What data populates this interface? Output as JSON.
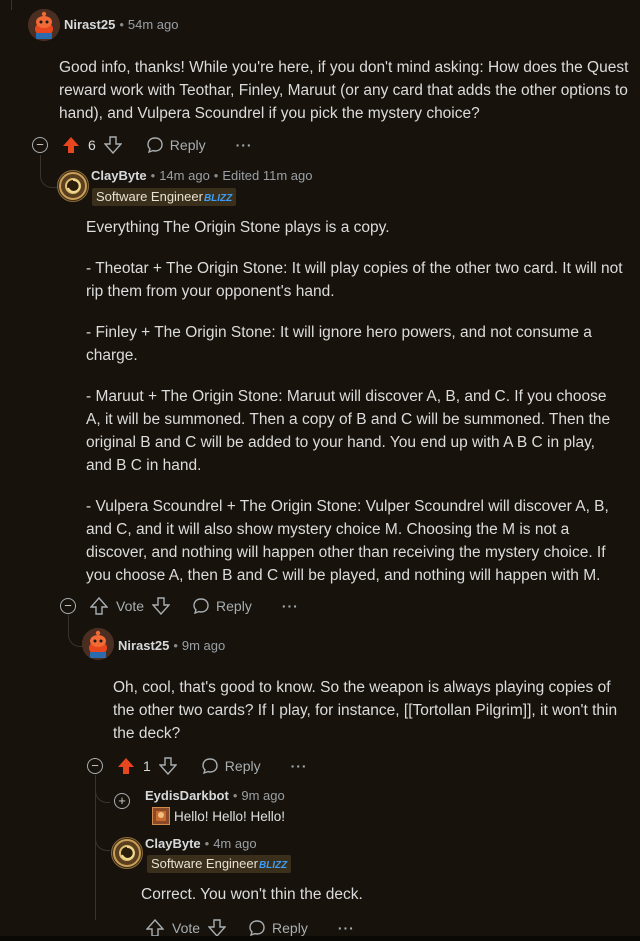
{
  "comments": [
    {
      "user": "Nirast25",
      "time": "54m ago",
      "body": [
        "Good info, thanks! While you're here, if you don't mind asking: How does the Quest reward work with Teothar, Finley, Maruut (or any card that adds the other options to hand), and Vulpera Scoundrel if you pick the mystery choice?"
      ],
      "score": "6",
      "reply_label": "Reply",
      "more_label": "···"
    },
    {
      "user": "ClayByte",
      "time": "14m ago",
      "edited": "Edited 11m ago",
      "flair": "Software Engineer",
      "flair_badge": "BLIZZ",
      "body": [
        "Everything The Origin Stone plays is a copy.",
        "- Theotar + The Origin Stone: It will play copies of the other two card. It will not rip them from your opponent's hand.",
        "- Finley + The Origin Stone: It will ignore hero powers, and not consume a charge.",
        "- Maruut + The Origin Stone: Maruut will discover A, B, and C. If you choose A, it will be summoned. Then a copy of B and C will be summoned. Then the original B and C will be added to your hand. You end up with A B C in play, and B C in hand.",
        "- Vulpera Scoundrel + The Origin Stone: Vulper Scoundrel will discover A, B, and C, and it will also show mystery choice M. Choosing the M is not a discover, and nothing will happen other than receiving the mystery choice. If you choose A, then B and C will be played, and nothing will happen with M."
      ],
      "vote_label": "Vote",
      "reply_label": "Reply",
      "more_label": "···"
    },
    {
      "user": "Nirast25",
      "time": "9m ago",
      "body": [
        "Oh, cool, that's good to know. So the weapon is always playing copies of the other two cards? If I play, for instance, [[Tortollan Pilgrim]], it won't thin the deck?"
      ],
      "score": "1",
      "reply_label": "Reply",
      "more_label": "···"
    },
    {
      "user": "EydisDarkbot",
      "time": "9m ago",
      "body": [
        "Hello! Hello! Hello!"
      ]
    },
    {
      "user": "ClayByte",
      "time": "4m ago",
      "flair": "Software Engineer",
      "flair_badge": "BLIZZ",
      "body": [
        "Correct. You won't thin the deck."
      ],
      "vote_label": "Vote",
      "reply_label": "Reply",
      "more_label": "···"
    }
  ],
  "colors": {
    "upvoted": "#e8461e",
    "accent_blizz": "#3d9cf5",
    "background": "#17120b"
  }
}
